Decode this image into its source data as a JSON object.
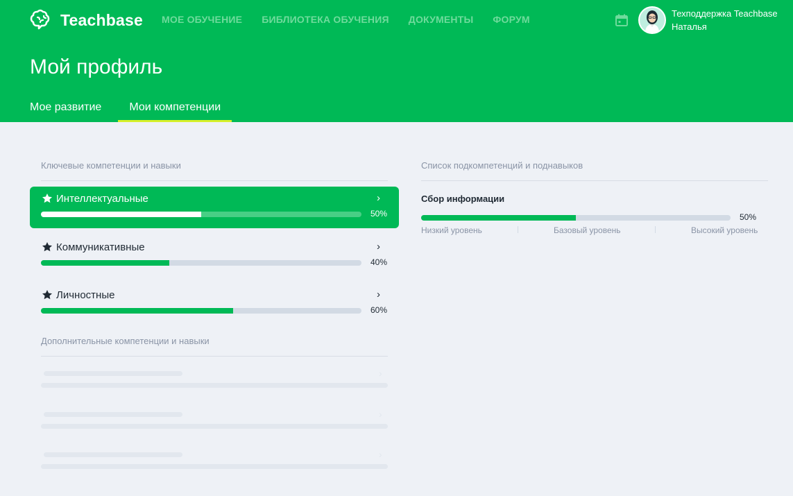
{
  "header": {
    "logo_text": "Teachbase",
    "nav": [
      "МОЕ ОБУЧЕНИЕ",
      "БИБЛИОТЕКА ОБУЧЕНИЯ",
      "ДОКУМЕНТЫ",
      "ФОРУМ"
    ],
    "user_name": "Техподдержка Teachbase",
    "user_subname": "Наталья",
    "icons": {
      "calendar": "calendar-icon",
      "logo": "brain-icon"
    }
  },
  "page": {
    "title": "Мой профиль",
    "tabs": [
      "Мое развитие",
      "Мои компетенции"
    ],
    "active_tab": 1
  },
  "left": {
    "key_title": "Ключевые компетенции и навыки",
    "competencies": [
      {
        "label": "Интеллектуальные",
        "progress": 50,
        "pct_label": "50%",
        "active": true
      },
      {
        "label": "Коммуникативные",
        "progress": 40,
        "pct_label": "40%",
        "active": false
      },
      {
        "label": "Личностные",
        "progress": 60,
        "pct_label": "60%",
        "active": false
      }
    ],
    "extra_title": "Дополнительные компетенции и навыки"
  },
  "right": {
    "title": "Список подкомпетенций и поднавыков",
    "sub": {
      "label": "Сбор информации",
      "progress": 50,
      "pct_label": "50%"
    },
    "levels": [
      "Низкий уровень",
      "Базовый уровень",
      "Высокий уровень"
    ]
  },
  "colors": {
    "brand": "#00b956",
    "tab_underline": "#d6f02a",
    "background": "#eef1f6"
  }
}
